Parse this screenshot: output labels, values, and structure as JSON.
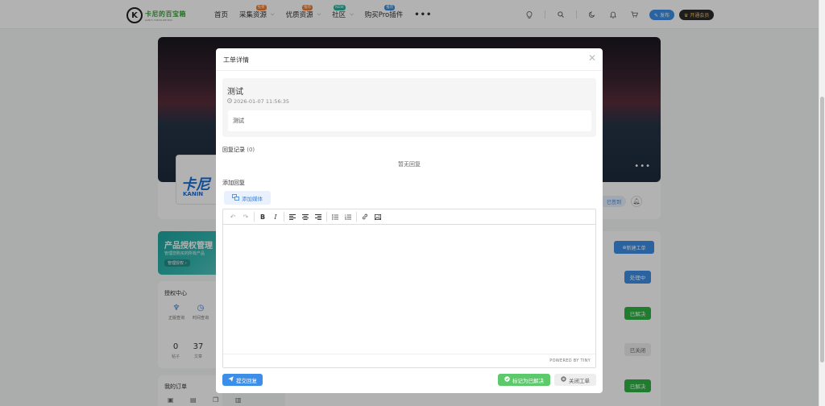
{
  "nav": {
    "logo_mark": "K",
    "logo_title": "卡尼的百宝箱",
    "logo_sub": "KANI'S TREASURE BOX",
    "items": [
      {
        "label": "首页",
        "badge": "",
        "chevron": false
      },
      {
        "label": "采集资源",
        "badge": "免费",
        "badge_color": "orange",
        "chevron": true
      },
      {
        "label": "优质资源",
        "badge": "推荐",
        "badge_color": "orange",
        "chevron": true
      },
      {
        "label": "社区",
        "badge": "NEW",
        "badge_color": "teal",
        "chevron": true
      },
      {
        "label": "购买Pro插件",
        "badge": "推荐",
        "badge_color": "blue",
        "chevron": false
      }
    ],
    "more": "•••",
    "publish_label": "发布",
    "vip_label": "开通会员"
  },
  "background": {
    "banner_dots": "•••",
    "profile_logo_text": "卡尼",
    "profile_logo_sub": "KANIN",
    "signed_label": "已签到",
    "promo": {
      "title": "产品授权管理",
      "desc": "管理您购买的所有产品",
      "button": "管理授权 ›"
    },
    "auth_center": {
      "title": "授权中心",
      "items": [
        {
          "icon": "♆",
          "label": "正版查询"
        },
        {
          "icon": "◷",
          "label": "时间查询"
        }
      ],
      "stats": [
        {
          "value": "0",
          "label": "帖子"
        },
        {
          "value": "37",
          "label": "文章"
        }
      ]
    },
    "orders_title": "我的订单",
    "new_ticket_label": "新建工单",
    "statuses": [
      {
        "label": "处理中",
        "kind": "processing"
      },
      {
        "label": "已解决",
        "kind": "solved"
      },
      {
        "label": "已关闭",
        "kind": "closed"
      },
      {
        "label": "已解决",
        "kind": "solved"
      }
    ]
  },
  "modal": {
    "title": "工单详情",
    "close": "✕",
    "ticket": {
      "title": "测试",
      "time": "2026-01-07 11:56:35",
      "content": "测试"
    },
    "reply_label": "回复记录",
    "reply_count": "(0)",
    "no_reply": "暂无回复",
    "add_reply_label": "添加回复",
    "add_media_label": "添加媒体",
    "powered_by": "POWERED BY TINY",
    "submit_label": "提交回复",
    "mark_solved_label": "标记为已解决",
    "close_ticket_label": "关闭工单"
  },
  "colors": {
    "primary": "#3d8ee6",
    "success": "#5cc96a",
    "solved": "#2fb344"
  }
}
